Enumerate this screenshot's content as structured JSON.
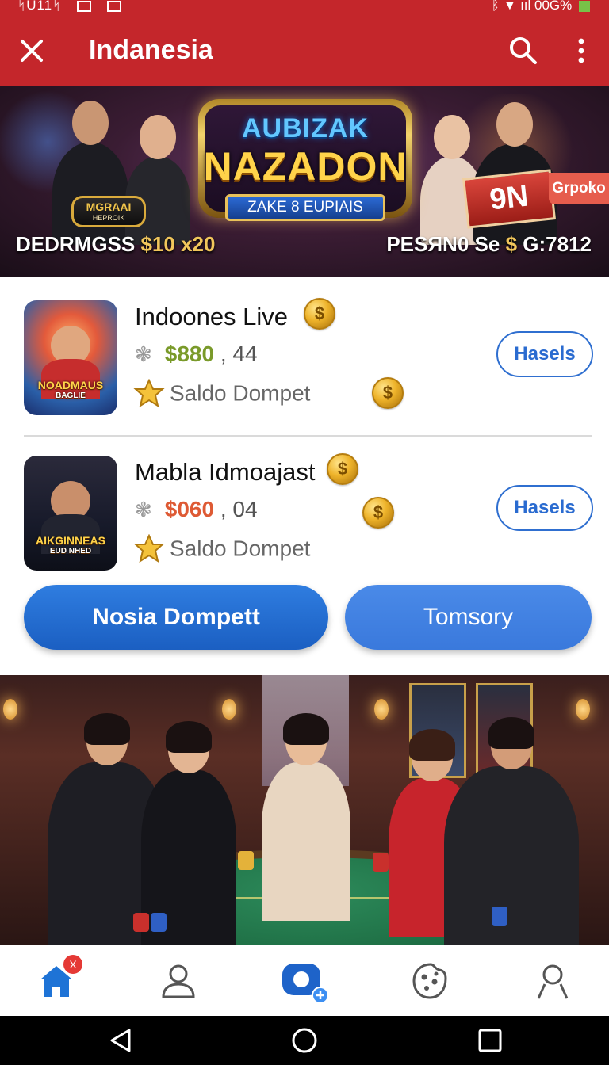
{
  "status_bar": {
    "left_text": "ᛋU11ᛋ",
    "right_text": "ᛒ ▼ ııl 00G%"
  },
  "app_bar": {
    "title": "Indanesia"
  },
  "hero": {
    "logo_line_1": "AUBIZAK",
    "logo_line_2": "NAZADON",
    "ribbon": "ZAKE 8 EUPIAIS",
    "badge_title": "MGRAAI",
    "badge_sub": "HEPROIK",
    "sign_text": "9N",
    "corner_tag": "Grpoko",
    "left_label": "DEDRMGSS",
    "left_amount": "$10 x20",
    "right_label": "PESЯN0 Se",
    "right_currency": "$",
    "right_amount": "G:7812"
  },
  "games": [
    {
      "title": "Indoones Live",
      "amount": "$880",
      "amount_suffix": ", 44",
      "saldo_label": "Saldo Dompet",
      "thumb_label": "NOADMAUS",
      "thumb_sub": "BAGLIE",
      "action_label": "Hasels"
    },
    {
      "title": "Mabla Idmoajast",
      "amount": "$060",
      "amount_suffix": ", 04",
      "saldo_label": "Saldo Dompet",
      "thumb_label": "AIKGINNEAS",
      "thumb_sub": "EUD NHED",
      "action_label": "Hasels"
    }
  ],
  "actions": {
    "primary_label": "Nosia Dompett",
    "secondary_label": "Tomsory"
  },
  "bottom_nav": {
    "home_badge": "X",
    "items": [
      "home-icon",
      "profile-icon",
      "wallet-icon",
      "cookie-icon",
      "account-icon"
    ]
  },
  "colors": {
    "app_bar": "#c4262b",
    "accent_blue": "#2a6bd0",
    "money_green": "#7a9a2a",
    "money_red": "#de5a34"
  }
}
